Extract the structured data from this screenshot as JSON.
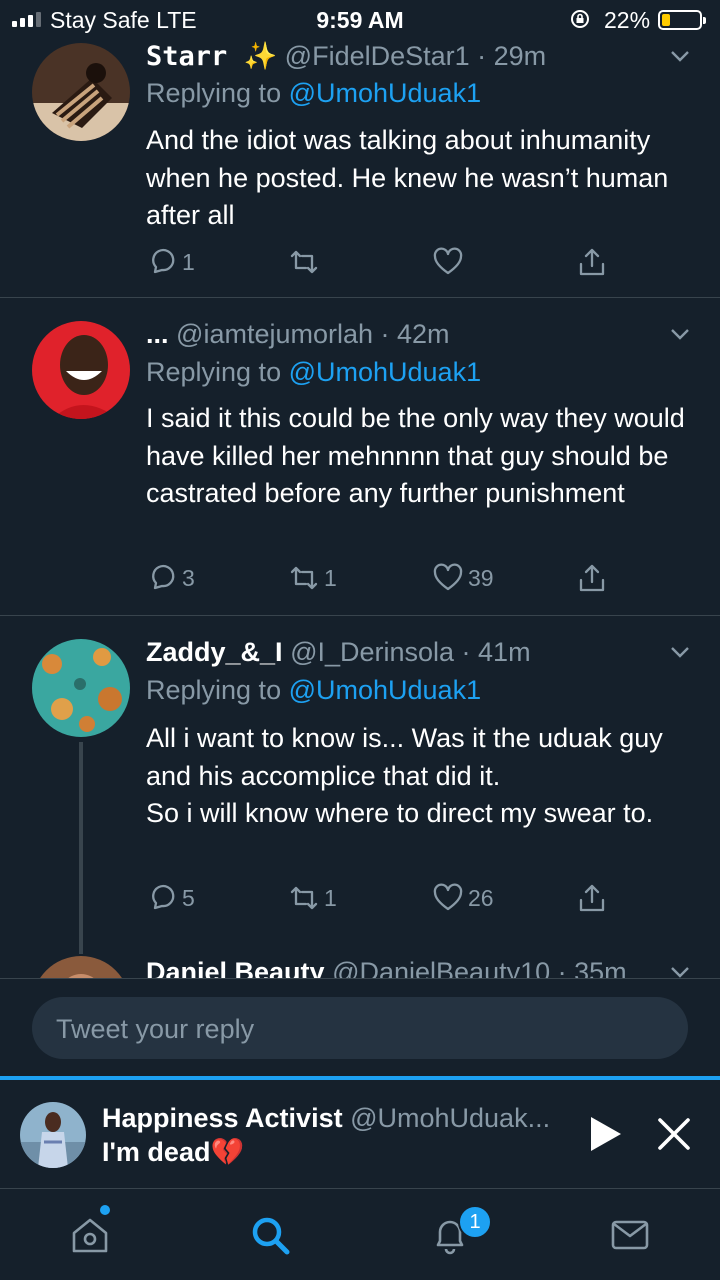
{
  "status_bar": {
    "carrier": "Stay Safe  LTE",
    "time": "9:59 AM",
    "battery_percent": "22%",
    "battery_level": 0.22,
    "battery_color": "#ffcc00"
  },
  "tweets": [
    {
      "name": "Starr ✨",
      "handle": "@FidelDeStar1 · 29m",
      "replying_prefix": "Replying to ",
      "replying_handle": "@UmohUduak1",
      "text": "And the idiot was talking about inhumanity when he posted. He knew he wasn’t human after all",
      "replies": "1",
      "retweets": "",
      "likes": ""
    },
    {
      "name": "...",
      "handle": "@iamtejumorlah · 42m",
      "replying_prefix": "Replying to ",
      "replying_handle": "@UmohUduak1",
      "text": "I said it this could be the only way they would have killed her mehnnnn that guy should be castrated before any further punishment",
      "replies": "3",
      "retweets": "1",
      "likes": "39"
    },
    {
      "name": "Zaddy_&_I",
      "handle": "@I_Derinsola · 41m",
      "replying_prefix": "Replying to ",
      "replying_handle": "@UmohUduak1",
      "text": "All i want to know is... Was it the uduak guy and his accomplice that did it.\nSo i will know where to direct my swear to.",
      "replies": "5",
      "retweets": "1",
      "likes": "26"
    },
    {
      "name": "Daniel Beauty",
      "handle": "@DanielBeauty10 · 35m"
    }
  ],
  "composer": {
    "placeholder": "Tweet your reply"
  },
  "media_player": {
    "name": "Happiness Activist",
    "handle": "@UmohUduak...",
    "text": "I'm dead💔",
    "progress": 1.0
  },
  "tabbar": {
    "notifications_badge": "1"
  },
  "colors": {
    "background": "#15202b",
    "accent": "#1da1f2",
    "secondary_text": "#8899a6",
    "divider": "#38444d"
  }
}
